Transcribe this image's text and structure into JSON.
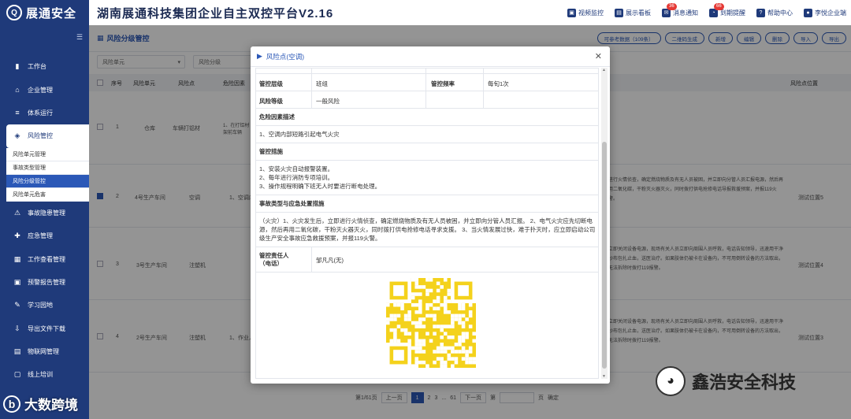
{
  "brand": {
    "logo": "Q",
    "name": "展通安全"
  },
  "app_title": "湖南展通科技集团企业自主双控平台V2.16",
  "top_actions": [
    {
      "icon": "monitor-icon",
      "glyph": "▣",
      "label": "视频监控",
      "badge": ""
    },
    {
      "icon": "dashboard-icon",
      "glyph": "▤",
      "label": "展示看板",
      "badge": ""
    },
    {
      "icon": "message-icon",
      "glyph": "✉",
      "label": "消息通知",
      "badge": "36"
    },
    {
      "icon": "bell-icon",
      "glyph": "◔",
      "label": "到期提醒",
      "badge": "66"
    },
    {
      "icon": "help-icon",
      "glyph": "?",
      "label": "帮助中心",
      "badge": ""
    },
    {
      "icon": "user-icon",
      "glyph": "●",
      "label": "李悦企业端",
      "badge": ""
    }
  ],
  "sidebar": {
    "items": [
      {
        "icon": "▮",
        "label": "工作台"
      },
      {
        "icon": "⌂",
        "label": "企业管理"
      },
      {
        "icon": "≡",
        "label": "体系运行"
      },
      {
        "icon": "◈",
        "label": "风险管控"
      },
      {
        "icon": "⚠",
        "label": "事故隐患管理"
      },
      {
        "icon": "✚",
        "label": "应急管理"
      },
      {
        "icon": "▦",
        "label": "工作查看管理"
      },
      {
        "icon": "▣",
        "label": "预警报告管理"
      },
      {
        "icon": "✎",
        "label": "学习园地"
      },
      {
        "icon": "⇩",
        "label": "导出文件下载"
      },
      {
        "icon": "▤",
        "label": "物联网管理"
      },
      {
        "icon": "▢",
        "label": "线上培训"
      }
    ],
    "sub_items": [
      "风险单元管理",
      "事故类型管理",
      "风险分级管控",
      "风险单元危害"
    ]
  },
  "main": {
    "title": "风险分级管控",
    "toolbar": [
      "可参考数据（109条）",
      "二维码生成",
      "新增",
      "编辑",
      "删除",
      "导入",
      "导出"
    ],
    "filters": [
      "风险单元",
      "风险分级"
    ],
    "headers": {
      "seq": "序号",
      "unit": "风险单元",
      "point": "风险点",
      "factor": "危险因素",
      "location": "风险点位置"
    },
    "rows": [
      {
        "seq": "1",
        "unit": "仓库",
        "point": "车辆打铝材",
        "factor": "1、在打铝材架前车辆",
        "measure": "",
        "location": ""
      },
      {
        "seq": "2",
        "unit": "4号生产车间",
        "point": "空调",
        "factor": "1、空调内部",
        "measure": "进行火情侦查，确定燃烧物质及有无人员被困，并立即向分管人员汇报电源，然后再用二氧化碳，干粉灭火器灭火，同时拨打供电抢修电话导报救援预案，并报119火警。",
        "location": "测试位置5"
      },
      {
        "seq": "3",
        "unit": "3号生产车间",
        "point": "注塑机",
        "factor": "",
        "measure": "立即关闭设备电源，现场有关人员立即向周围人员呼救，电话告知领导，迅速用干净纱布包扎止血，送医治疗。如果肢体仍被卡在设备内，不可用倒转设备的方法取出，无法拆除时拨打119报警。",
        "location": "测试位置4"
      },
      {
        "seq": "4",
        "unit": "2号生产车间",
        "point": "注塑机",
        "factor": "1、作业人",
        "measure": "立即关闭设备电源，现场有关人员立即向周围人员呼救，电话告知领导，迅速用干净纱布包扎止血，送医治疗。如果肢体仍被卡在设备内，不可用倒转设备的方法取出，无法拆除时拨打119报警。",
        "location": "测试位置3"
      }
    ]
  },
  "pager": {
    "summary": "第1/61页",
    "prev": "上一页",
    "pages": [
      "1",
      "2",
      "3",
      "...",
      "61"
    ],
    "next": "下一页",
    "goto_prefix": "第",
    "goto_suffix": "页",
    "confirm": "确定"
  },
  "modal": {
    "title": "风险点(空调)",
    "control_level_label": "管控层级",
    "control_level": "班组",
    "frequency_label": "管控频率",
    "frequency": "每旬1次",
    "risk_grade_label": "风险等级",
    "risk_grade": "一般风险",
    "hazard_title": "危险因素描述",
    "hazard_text": "1、空调内部短路引起电气火灾",
    "measures_title": "管控措施",
    "measures_lines": [
      "1、安装火灾自动报警装置。",
      "2、每年进行消防专项培训。",
      "3、操作规程明确下班无人时要进行断电处理。"
    ],
    "emergency_title": "事故类型与应急处置措施",
    "emergency_text": "（火灾）1、火灾发生后，立即进行火情侦查，确定燃烧物质及有无人员被困，并立即向分管人员汇报。 2、电气火灾应先切断电源，然后再用二氧化碳，干粉灭火器灭火，同时拨打供电抢修电话寻求支援。 3、当火情发展过快，难于扑灭时，应立即启动公司级生产安全事故应急救援预案，并报119火警。",
    "person_label_1": "管控责任人",
    "person_label_2": "（电话）",
    "person": "邹凡凡(无)"
  },
  "watermarks": {
    "left": "大数跨境",
    "right": "鑫浩安全科技"
  },
  "colors": {
    "primary": "#1f3a7a",
    "accent": "#2b58b7",
    "qr": "#f4d21c",
    "badge": "#e53935"
  }
}
